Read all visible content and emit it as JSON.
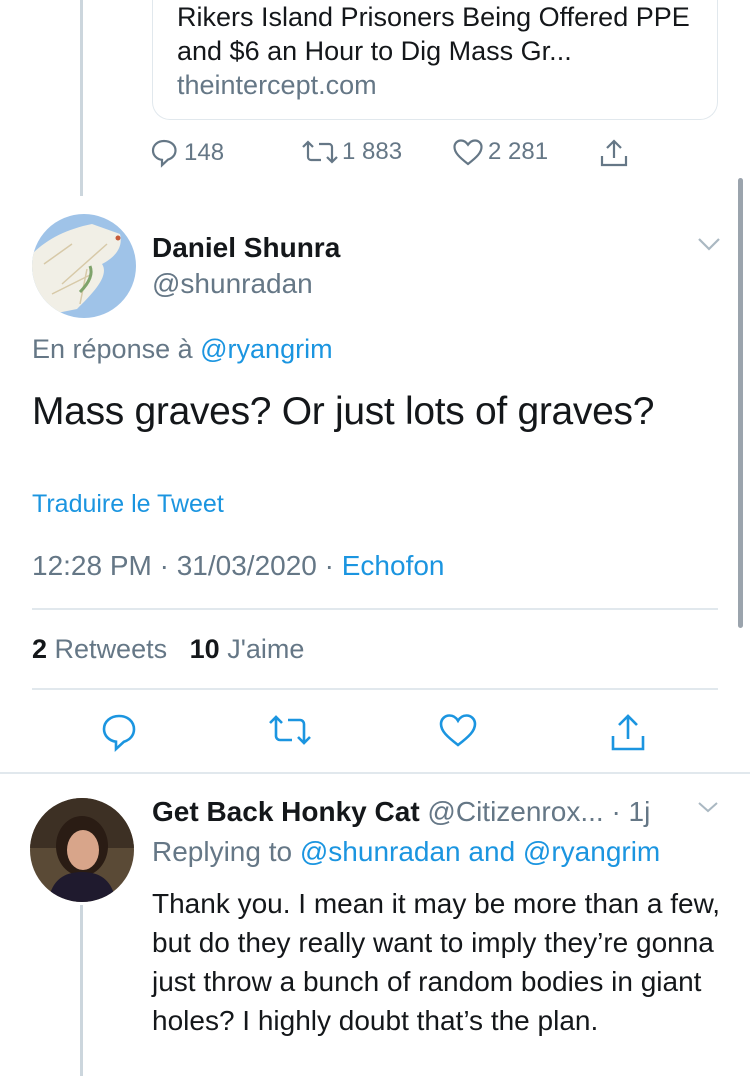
{
  "quoted_card": {
    "title": "Rikers Island Prisoners Being Offered PPE and $6 an Hour to Dig Mass Gr...",
    "domain": "theintercept.com"
  },
  "parent_actions": {
    "replies": "148",
    "retweets": "1 883",
    "likes": "2 281"
  },
  "tweet": {
    "author_name": "Daniel Shunra",
    "author_handle": "@shunradan",
    "reply_prefix": "En réponse à",
    "reply_to": "@ryangrim",
    "text": "Mass graves? Or just lots of graves?",
    "translate": "Traduire le Tweet",
    "time": "12:28 PM · 31/03/2020 · ",
    "source": "Echofon",
    "retweet_count": "2",
    "retweet_label": "Retweets",
    "like_count": "10",
    "like_label": "J'aime"
  },
  "reply": {
    "author_name": "Get Back Honky Cat",
    "author_handle": "@Citizenrox...",
    "age": "· 1j",
    "replying_prefix": "Replying to",
    "replying_user1": "@shunradan",
    "replying_and": "and",
    "replying_user2": "@ryangrim",
    "text": "Thank you.  I mean it may be more than a few, but do they really want to imply they’re gonna just throw a bunch of random bodies in giant holes?  I highly doubt that’s the plan."
  },
  "colors": {
    "link_blue": "#1b95e0",
    "secondary_gray": "#657786",
    "divider": "#e1e8ed"
  },
  "icons": [
    "reply-icon",
    "retweet-icon",
    "like-icon",
    "share-icon",
    "chevron-down-icon"
  ]
}
